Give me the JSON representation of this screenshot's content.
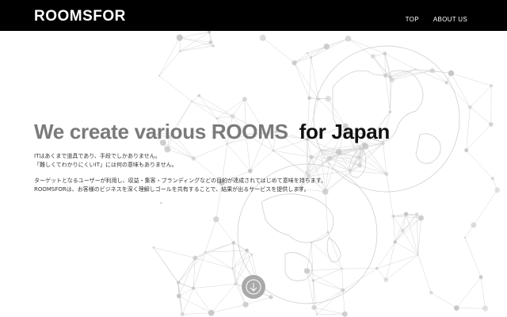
{
  "header": {
    "logo": "ROOMSFOR",
    "nav": [
      {
        "label": "TOP"
      },
      {
        "label": "ABOUT US"
      }
    ]
  },
  "hero": {
    "headline_main": "We create various ROOMS",
    "headline_accent": "for Japan",
    "para1": [
      "ITはあくまで道具であり、手段でしかありません。",
      "「難しくてわかりにくいIT」には何の意味もありません。"
    ],
    "para2": [
      "ターゲットとなるユーザーが利用し、収益・集客・ブランディングなどの目的が達成されてはじめて意味を持ちます。",
      "ROOMSFORは、お客様のビジネスを深く理解しゴールを共有することで、結果が出るサービスを提供します。"
    ]
  },
  "scroll_button": {
    "icon": "arrow-down-icon"
  },
  "colors": {
    "header_bg": "#000000",
    "headline_grey": "#7a7a7a",
    "headline_dark": "#111111",
    "scroll_btn": "#a9a9a9"
  }
}
